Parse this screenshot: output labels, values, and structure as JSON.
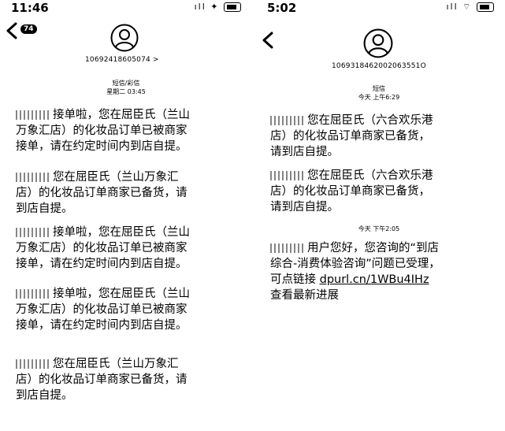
{
  "left": {
    "time": "11:46",
    "status_icons": "ıll ✦",
    "back_badge": "74",
    "sender_number": "10692418605074 >",
    "meta_line1": "短信/彩信",
    "meta_line2": "星期二 03:45",
    "messages": [
      "接单啦，您在屈臣氏（兰山万象汇店）的化妆品订单已被商家接单，请在约定时间内到店自提。",
      "您在屈臣氏（兰山万象汇店）的化妆品订单商家已备货，请到店自提。",
      "接单啦，您在屈臣氏（兰山万象汇店）的化妆品订单已被商家接单，请在约定时间内到店自提。",
      "接单啦，您在屈臣氏（兰山万象汇店）的化妆品订单已被商家接单，请在约定时间内到店自提。",
      "您在屈臣氏（兰山万象汇店）的化妆品订单商家已备货，请到店自提。"
    ]
  },
  "right": {
    "time": "5:02",
    "status_icons": "ıll ⌔",
    "sender_number": "1069318462002063551O",
    "meta_line1": "短信",
    "meta_line2": "今天 上午6:29",
    "messages": [
      "您在屈臣氏（六合欢乐港店）的化妆品订单商家已备货，请到店自提。",
      "您在屈臣氏（六合欢乐港店）的化妆品订单商家已备货，请到店自提。"
    ],
    "time_divider": "今天 下午2:05",
    "last_message_text": "用户您好，您咨询的“到店综合-消费体验咨询”问题已受理，可点链接 ",
    "last_message_link": "dpurl.cn/1WBu4IHz",
    "last_message_tail": " 查看最新进展"
  }
}
